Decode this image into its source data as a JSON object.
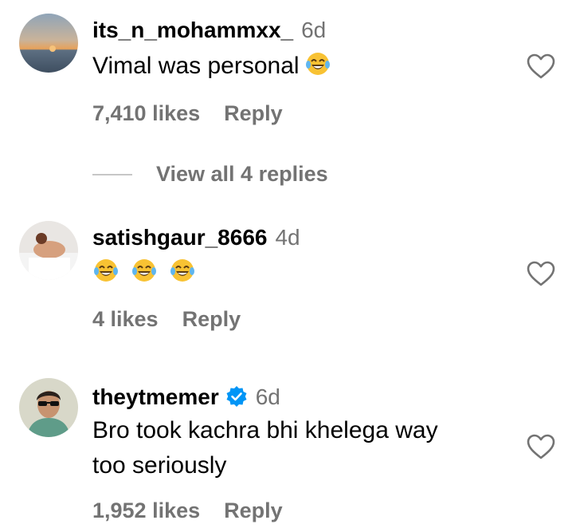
{
  "comments": [
    {
      "username": "its_n_mohammxx_",
      "time": "6d",
      "text": "Vimal was personal",
      "emoji_icon": "face-with-tears-of-joy",
      "emoji_count": 1,
      "likes": "7,410 likes",
      "reply_label": "Reply",
      "verified": false,
      "avatar_icon": "sunset-sea-avatar"
    },
    {
      "username": "satishgaur_8666",
      "time": "4d",
      "text": "",
      "emoji_icon": "face-with-tears-of-joy",
      "emoji_count": 3,
      "likes": "4 likes",
      "reply_label": "Reply",
      "verified": false,
      "avatar_icon": "person-lying-avatar"
    },
    {
      "username": "theytmemer",
      "time": "6d",
      "text": "Bro took kachra bhi khelega way too seriously",
      "likes": "1,952 likes",
      "reply_label": "Reply",
      "verified": true,
      "avatar_icon": "sunglasses-boy-avatar"
    }
  ],
  "view_replies": "View all 4 replies",
  "colors": {
    "secondary_text": "#737373",
    "verified_blue": "#0095f6",
    "divider": "#c7c7c7"
  }
}
